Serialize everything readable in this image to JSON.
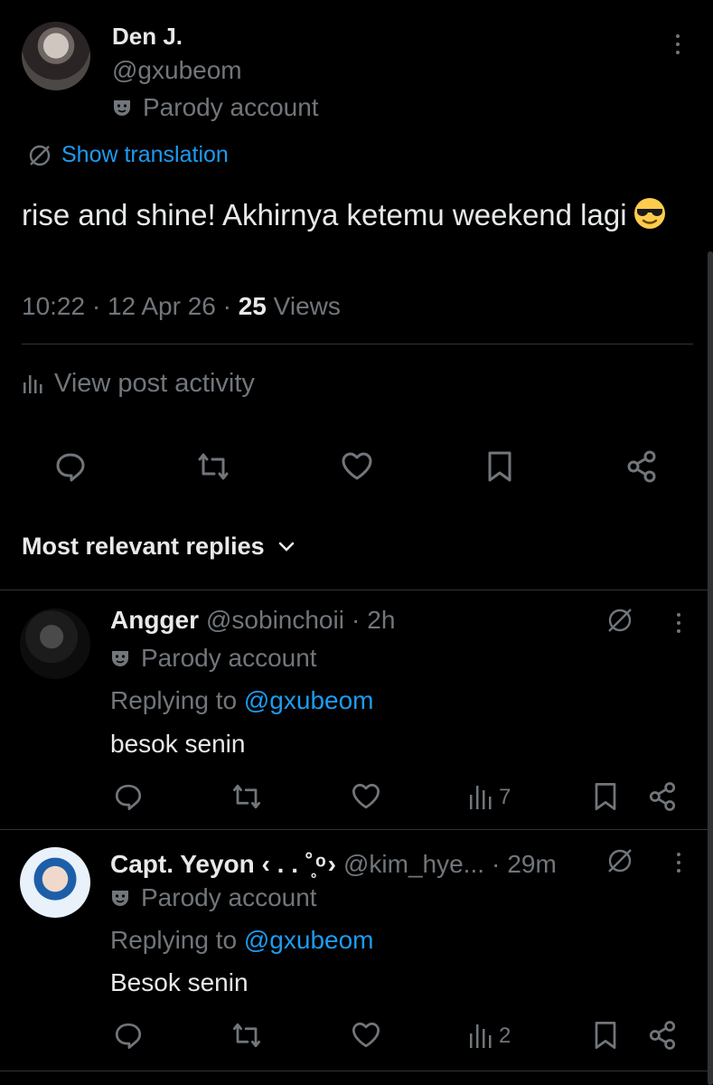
{
  "post": {
    "author_name": "Den J.",
    "author_handle": "@gxubeom",
    "parody_label": "Parody account",
    "translation_label": "Show translation",
    "text": "rise and shine! Akhirnya ketemu weekend lagi",
    "emoji": "sunglasses-emoji",
    "time": "10:22",
    "date": "12 Apr 26",
    "views_count": "25",
    "views_label": "Views",
    "activity_label": "View post activity"
  },
  "replies_sort": {
    "label": "Most relevant replies"
  },
  "replies": [
    {
      "name": "Angger",
      "handle": "@sobinchoii",
      "time": "2h",
      "parody_label": "Parody account",
      "replying_prefix": "Replying to",
      "replying_handle": "@gxubeom",
      "text": "besok senin",
      "views": "7"
    },
    {
      "name": "Capt. Yeyon ‹ . . ˚̥ ͦ ›",
      "name_main": "Capt. Yeyon",
      "name_deco": "‹ . . ˚̥ ͦ ›",
      "handle": "@kim_hye...",
      "time": "29m",
      "parody_label": "Parody account",
      "replying_prefix": "Replying to",
      "replying_handle": "@gxubeom",
      "text": "Besok senin",
      "views": "2"
    }
  ],
  "colors": {
    "background": "#000000",
    "text": "#e7e9ea",
    "muted": "#71767b",
    "accent": "#1d9bf0",
    "divider": "#2f3336"
  }
}
